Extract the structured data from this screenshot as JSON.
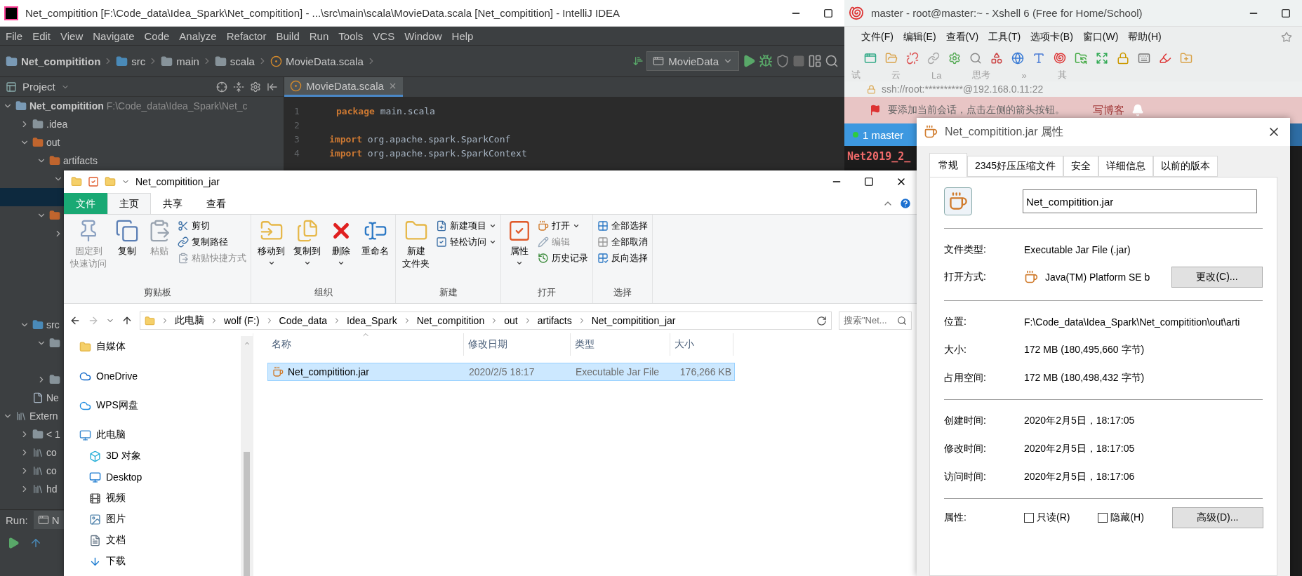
{
  "ide": {
    "title": "Net_compitition [F:\\Code_data\\Idea_Spark\\Net_compitition] - ...\\src\\main\\scala\\MovieData.scala [Net_compitition] - IntelliJ IDEA",
    "menu": [
      "File",
      "Edit",
      "View",
      "Navigate",
      "Code",
      "Analyze",
      "Refactor",
      "Build",
      "Run",
      "Tools",
      "VCS",
      "Window",
      "Help"
    ],
    "breadcrumb": [
      "Net_compitition",
      "src",
      "main",
      "scala",
      "MovieData.scala"
    ],
    "run_config": "MovieData",
    "project_label": "Project",
    "tree": [
      {
        "label": "Net_compitition",
        "path": "F:\\Code_data\\Idea_Spark\\Net_c",
        "kind": "module",
        "expanded": true,
        "selected": false,
        "children": [
          {
            "label": ".idea",
            "kind": "folder",
            "expanded": false,
            "selected": false
          },
          {
            "label": "out",
            "kind": "excluded",
            "expanded": true,
            "selected": false,
            "children": [
              {
                "label": "artifacts",
                "kind": "excluded",
                "expanded": true,
                "selected": false,
                "children": [
                  {
                    "expanded": true,
                    "selected": false,
                    "children": [
                      {
                        "selected": true
                      }
                    ]
                  }
                ]
              },
              {
                "kind": "excluded",
                "expanded": true,
                "selected": false,
                "children": [
                  {
                    "expanded": false,
                    "selected": false
                  }
                ]
              }
            ]
          },
          {
            "label": "src",
            "kind": "source",
            "expanded": true,
            "selected": false,
            "children": [
              {
                "kind": "folder",
                "expanded": true,
                "selected": false
              },
              {
                "kind": "folder",
                "expanded": false,
                "selected": false
              }
            ]
          },
          {
            "label": "Ne",
            "kind": "file",
            "selected": false
          }
        ]
      },
      {
        "label": "Extern",
        "kind": "library",
        "expanded": true,
        "selected": false,
        "children": [
          {
            "label": "< 1",
            "kind": "folder",
            "expanded": false,
            "selected": false
          },
          {
            "label": "co",
            "kind": "library",
            "expanded": false,
            "selected": false
          },
          {
            "label": "co",
            "kind": "library",
            "expanded": false,
            "selected": false
          },
          {
            "label": "hd",
            "kind": "library",
            "expanded": false,
            "selected": false
          }
        ]
      }
    ],
    "editor_tab": "MovieData.scala",
    "code": [
      {
        "number": "1",
        "keyword": "package",
        "text": "main.scala"
      },
      {
        "number": "2"
      },
      {
        "number": "3",
        "keyword": "import",
        "text": "org.apache.spark.SparkConf"
      },
      {
        "number": "4",
        "keyword": "import",
        "text": "org.apache.spark.SparkContext"
      }
    ],
    "run_label": "Run:",
    "run_tab": "N"
  },
  "xshell": {
    "title": "master - root@master:~ - Xshell 6 (Free for Home/School)",
    "menu": [
      "文件(F)",
      "编辑(E)",
      "查看(V)",
      "工具(T)",
      "选项卡(B)",
      "窗口(W)",
      "帮助(H)"
    ],
    "bookmarks": [
      "试",
      "云",
      "La",
      "思考",
      "»",
      "其"
    ],
    "address": "ssh://root:**********@192.168.0.11:22",
    "notice": "要添加当前会话，点击左侧的箭头按钮。",
    "blog_button": "写博客",
    "session_tab": "1 master",
    "terminal": [
      "Net2019_2_"
    ]
  },
  "explorer": {
    "title": "Net_compitition_jar",
    "tabs": [
      {
        "label": "文件",
        "kind": "file",
        "selected": false
      },
      {
        "label": "主页",
        "kind": "tab",
        "selected": true
      },
      {
        "label": "共享",
        "kind": "tab",
        "selected": false
      },
      {
        "label": "查看",
        "kind": "tab",
        "selected": false
      }
    ],
    "groups": [
      {
        "label": "剪贴板",
        "items": [
          {
            "kind": "large",
            "lines": [
              "固定到",
              "快速访问"
            ],
            "disabled": true,
            "dropdown": false
          },
          {
            "kind": "large",
            "lines": [
              "复制"
            ],
            "disabled": false,
            "dropdown": false
          },
          {
            "kind": "large",
            "lines": [
              "粘贴"
            ],
            "disabled": true,
            "dropdown": false
          },
          {
            "kind": "stack",
            "items": [
              {
                "label": "剪切",
                "disabled": false,
                "dropdown": false
              },
              {
                "label": "复制路径",
                "disabled": false,
                "dropdown": false
              },
              {
                "label": "粘贴快捷方式",
                "disabled": true,
                "dropdown": false
              }
            ]
          }
        ]
      },
      {
        "label": "组织",
        "items": [
          {
            "kind": "large",
            "lines": [
              "移动到"
            ],
            "disabled": false,
            "dropdown": true
          },
          {
            "kind": "large",
            "lines": [
              "复制到"
            ],
            "disabled": false,
            "dropdown": true
          },
          {
            "kind": "large",
            "lines": [
              "删除"
            ],
            "disabled": false,
            "dropdown": true
          },
          {
            "kind": "large",
            "lines": [
              "重命名"
            ],
            "disabled": false,
            "dropdown": false
          }
        ]
      },
      {
        "label": "新建",
        "items": [
          {
            "kind": "large",
            "lines": [
              "新建",
              "文件夹"
            ],
            "disabled": false,
            "dropdown": false
          },
          {
            "kind": "stack",
            "items": [
              {
                "label": "新建项目",
                "disabled": false,
                "dropdown": true
              },
              {
                "label": "轻松访问",
                "disabled": false,
                "dropdown": true
              }
            ]
          }
        ]
      },
      {
        "label": "打开",
        "items": [
          {
            "kind": "large",
            "lines": [
              "属性"
            ],
            "disabled": false,
            "dropdown": true
          },
          {
            "kind": "stack",
            "items": [
              {
                "label": "打开",
                "disabled": false,
                "dropdown": true
              },
              {
                "label": "编辑",
                "disabled": true,
                "dropdown": false
              },
              {
                "label": "历史记录",
                "disabled": false,
                "dropdown": false
              }
            ]
          }
        ]
      },
      {
        "label": "选择",
        "items": [
          {
            "kind": "stack",
            "items": [
              {
                "label": "全部选择",
                "disabled": false,
                "dropdown": false
              },
              {
                "label": "全部取消",
                "disabled": false,
                "dropdown": false
              },
              {
                "label": "反向选择",
                "disabled": false,
                "dropdown": false
              }
            ]
          }
        ]
      }
    ],
    "address": [
      "此电脑",
      "wolf (F:)",
      "Code_data",
      "Idea_Spark",
      "Net_compitition",
      "out",
      "artifacts",
      "Net_compitition_jar"
    ],
    "search_placeholder": "搜索\"Net...",
    "nav": [
      "自媒体",
      "OneDrive",
      "WPS网盘",
      "此电脑",
      "3D 对象",
      "Desktop",
      "视频",
      "图片",
      "文档",
      "下载"
    ],
    "columns": [
      "名称",
      "修改日期",
      "类型",
      "大小"
    ],
    "files": [
      {
        "name": "Net_compitition.jar",
        "date": "2020/2/5 18:17",
        "type": "Executable Jar File",
        "size": "176,266 KB",
        "selected": true
      }
    ]
  },
  "properties": {
    "title": "Net_compitition.jar 属性",
    "tabs": [
      {
        "label": "常规",
        "selected": true
      },
      {
        "label": "2345好压压缩文件",
        "selected": false
      },
      {
        "label": "安全",
        "selected": false
      },
      {
        "label": "详细信息",
        "selected": false
      },
      {
        "label": "以前的版本",
        "selected": false
      }
    ],
    "name": "Net_compitition.jar",
    "sections": [
      [
        {
          "label": "文件类型:",
          "value": "Executable Jar File (.jar)"
        },
        {
          "label": "打开方式:",
          "value": "Java(TM) Platform SE b",
          "button": "更改(C)..."
        }
      ],
      [
        {
          "label": "位置:",
          "value": "F:\\Code_data\\Idea_Spark\\Net_compitition\\out\\arti"
        },
        {
          "label": "大小:",
          "value": "172 MB (180,495,660 字节)"
        },
        {
          "label": "占用空间:",
          "value": "172 MB (180,498,432 字节)"
        }
      ],
      [
        {
          "label": "创建时间:",
          "value": "2020年2月5日，18:17:05"
        },
        {
          "label": "修改时间:",
          "value": "2020年2月5日，18:17:05"
        },
        {
          "label": "访问时间:",
          "value": "2020年2月5日，18:17:06"
        }
      ]
    ],
    "attributes": {
      "label": "属性:",
      "checkboxes": [
        {
          "label": "只读(R)",
          "checked": false
        },
        {
          "label": "隐藏(H)",
          "checked": false
        }
      ],
      "button": "高级(D)..."
    }
  }
}
